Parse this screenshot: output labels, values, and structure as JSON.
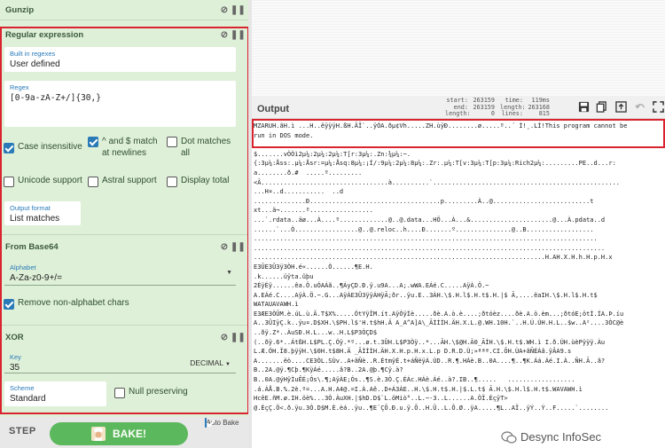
{
  "recipe": {
    "gunzip": {
      "title": "Gunzip"
    },
    "regex": {
      "title": "Regular expression",
      "builtin_label": "Built in regexes",
      "builtin_value": "User defined",
      "regex_label": "Regex",
      "regex_value": "[0-9a-zA-Z+/]{30,}",
      "case_insensitive": "Case insensitive",
      "caret_dollar": "^ and $ match at newlines",
      "dot_matches_all": "Dot matches all",
      "unicode_support": "Unicode support",
      "astral_support": "Astral support",
      "display_total": "Display total",
      "output_format_label": "Output format",
      "output_format_value": "List matches"
    },
    "from_base64": {
      "title": "From Base64",
      "alphabet_label": "Alphabet",
      "alphabet_value": "A-Za-z0-9+/=",
      "remove_non_alphabet": "Remove non-alphabet chars"
    },
    "xor": {
      "title": "XOR",
      "key_label": "Key",
      "key_value": "35",
      "key_format": "DECIMAL",
      "scheme_label": "Scheme",
      "scheme_value": "Standard",
      "null_preserving": "Null preserving"
    }
  },
  "bakebar": {
    "step_label": "STEP",
    "bake_label": "BAKE!",
    "autobake_label": "Auto Bake"
  },
  "output": {
    "title": "Output",
    "stats": {
      "start_label": "start:",
      "start_value": "263159",
      "end_label": "end:",
      "end_value": "263159",
      "length_label": "length:",
      "length_value": "0",
      "time_label": "time:",
      "time_value": "119ms",
      "olength_label": "length:",
      "olength_value": "263168",
      "lines_label": "lines:",
      "lines_value": "815"
    },
    "lines": [
      "MZARUH.ãH.ì ...H..êÿÿÿH.ßH.ÂÎ`..ÿÓA.ðµ¢Vh.....ZH.ùÿÐ........ø.....º..´ Í!¸.LÍ!This program cannot be",
      "run in DOS mode.",
      "",
      "$.......vÒÒì2µ¼:2µ¼:2µ¼:T[r:3µ¼:.Zn:¾µ¼:~.",
      "{:3µ¼:Åss:.µ¼:Åsr:=µ¼:Åsq:8µ¼:¡Í/:9µ¼:2µ¼:8µ¼:.Zr:.µ¼:T[v:3µ¼:T[p:3µ¼:Rich2µ¼:.........PE..d...r:",
      "a........ð.#  .....º.........",
      "<Â..................................à..........`..................................................",
      "...H¤..d...........  ..d",
      "..............Ð...................................p.........À..@..........................t",
      "xt...ä¬.......º.................",
      "...`.rdata..äø...À....º.............@..@.data...HÖ...À...&......................@...À.pdata..d",
      "......`...Ò.................@..@.reloc..h....Ð.......º...............@..B..................",
      "............................................................................................",
      "..............................................................................................",
      "..............................................................................H.AH.X.H.h.H.p.H.x",
      "E3ÛE3Û3ÿ3ÒH.é«......Ò......¶E.H.",
      ".k......üÿta.ûþu",
      "2ÉÿÉÿ......êa.Ö.uÓAÁã..¶ÁyÇD.Ð.ÿ.u9A...A;.wWA.EÁé.C.....AÿÀ.Ö.~",
      "A.EÁé.C....AÿÀ.Ö.~.G...AÿÁE3Û3ÿÿÁHÿÃ;ðr..ÿu.E..3ÀH.\\$.H.l$.H.t$.H.|$ Ã,....ëaIH.\\$.H.l$.H.t$",
      "WATAUAVAWH.ì",
      "E3ÆE3ÒÛM.è.úL.ù.Ä.T$X%.....ÓtYÿÏM.ít.AÿÓÿÍè.....ðè.A.ò.è....;ðtóèz....ðè.A.ö.èm...;ðtóE;ötÌ.ÍA.Þ.íu",
      "A..3ÛIÿÇ.k..ÿu¤.D$XH.\\$PH.l$'H.t$hH.Ä A_A^A]A\\_ÃÌÌÌH.ÄH.X.L.@.WH.10H.`..H.Ú.ÚH.H.L..$w..A²....3ÒC@è",
      "..ðÿ.Z*..ÀuSÐ.H.L...w..H.L$P3ÒÇD$",
      "(..ðÿ.6*..ÁtßH.L$PL.Ç.Óÿ.*º...ø.t.3ÛH.L$P3Òÿ..*...ÃH.\\$@H.Ä0_ÃÌH.\\$.H.t$.WH.ì I.ð.ÚH.ùèPÿÿÿ.Àu",
      "L.Æ.ÓH.Ï8.þÿÿH.\\$0H.t$8H.Ä _ÃÌÌÌH.ÄH.X.H.p.H.x.L.p D.R.D.Ù;»ªªª.CI.ÕH.ÙA+ãÑÉÁâ.ÿÂA9.s",
      "A.......ëò....CE3ÒL.SÙv..A+ãÑè..R.ÉtmÿÉ.t+áÑëÿÁ.ÙD..R.¶.HÁè.B..0A....¶..¶K.Áá.Áé.I.À..ÑH.Ã..ã?",
      "B..2A.@ÿ.¶Cþ.¶KÿÁé.....ã?B..2A.@þ.¶Cÿ.à?",
      "B..0A.@ýHÿÌuÊÉ¡Ós\\.¶;AÿÀE;Ós..¶S.è.3Ò.Ç.ÉÁc.HÁè.Áé..à?.IB..¶.....   ..................",
      ".á.ÁÅ.B.%.2è.º=...A.H.A4@.=I.À.Aê..D+Á3ÀE..H.\\$.H.t$.H.|$.L.t$ Ã.H.\\$.H.l$.H.t$.WAVAWH.ì",
      "HcêE.ñM.ø.IH.öè%...3Ò.ÀuXH.|$hD.D$`L.öMiò°..L.~-3..L......A.ÒÏ.ÉçÿT>",
      "@.ÈçÇ.Ö<.ð.ÿu.3Ò.D$M.È.èá..ÿu..¶E¨ÇÕ.Ð.u.ÿ.Õ..H.Û..L.Ô.Ø..ÿA.....¶L..AÏ..ÿÝ..Ý..F.....`........"
    ]
  },
  "watermark": {
    "text": "Desync InfoSec"
  }
}
